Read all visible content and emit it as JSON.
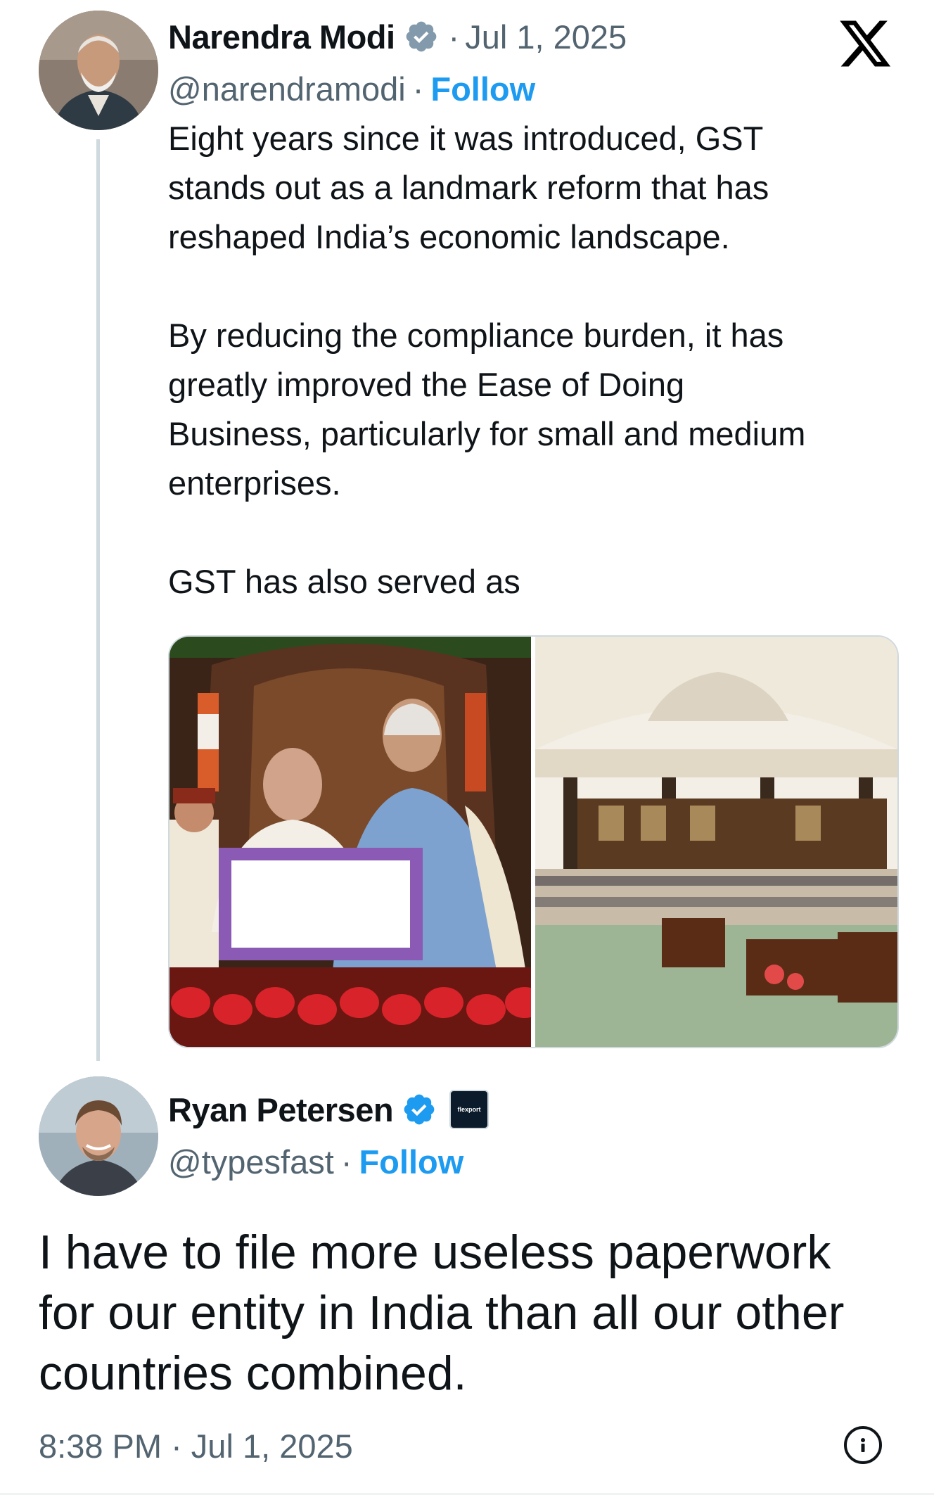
{
  "x_logo": "𝕏",
  "original_tweet": {
    "author_name": "Narendra Modi",
    "date": "Jul 1, 2025",
    "handle": "@narendramodi",
    "follow_label": "Follow",
    "separator": "·",
    "paragraph1": "Eight years since it was introduced, GST\nstands out as a landmark reform that has\nreshaped India’s economic landscape.",
    "paragraph2": "By reducing the compliance burden, it has\ngreatly improved the Ease of Doing\nBusiness, particularly for small and medium\nenterprises.",
    "paragraph3": "GST has also served as",
    "verified_color": "#829aab"
  },
  "reply_tweet": {
    "author_name": "Ryan Petersen",
    "handle": "@typesfast",
    "follow_label": "Follow",
    "separator": "·",
    "affiliate_badge_text": "flexport",
    "text": "I have to file more useless paperwork\nfor our entity in India than all our other\ncountries combined.",
    "timestamp": "8:38 PM · Jul 1, 2025",
    "verified_color": "#1d9bf0"
  },
  "colors": {
    "accent": "#1d9bf0",
    "muted": "#536471",
    "text": "#0f1419"
  }
}
